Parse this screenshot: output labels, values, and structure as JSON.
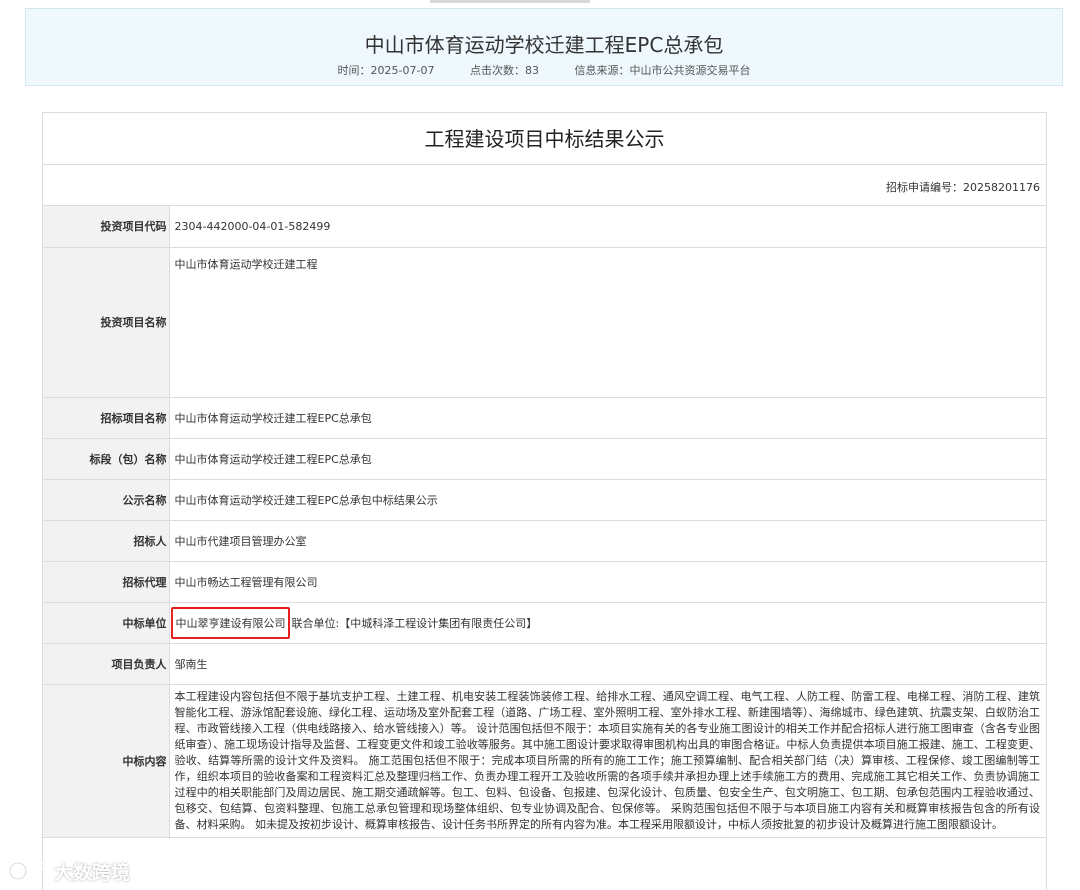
{
  "header": {
    "title": "中山市体育运动学校迁建工程EPC总承包",
    "time": "时间：2025-07-07",
    "clicks": "点击次数：83",
    "source": "信息来源：中山市公共资源交易平台"
  },
  "document": {
    "title": "工程建设项目中标结果公示",
    "apply_no": "招标申请编号：20258201176",
    "rows": [
      {
        "label": "投资项目代码",
        "value": "2304-442000-04-01-582499"
      },
      {
        "label": "投资项目名称",
        "value": "中山市体育运动学校迁建工程"
      },
      {
        "label": "招标项目名称",
        "value": "中山市体育运动学校迁建工程EPC总承包"
      },
      {
        "label": "标段（包）名称",
        "value": "中山市体育运动学校迁建工程EPC总承包"
      },
      {
        "label": "公示名称",
        "value": "中山市体育运动学校迁建工程EPC总承包中标结果公示"
      },
      {
        "label": "招标人",
        "value": "中山市代建项目管理办公室"
      },
      {
        "label": "招标代理",
        "value": "中山市畅达工程管理有限公司"
      },
      {
        "label": "中标单位",
        "winner": "中山翠亨建设有限公司",
        "partner": "联合单位:【中城科泽工程设计集团有限责任公司】"
      },
      {
        "label": "项目负责人",
        "value": "邹南生"
      },
      {
        "label": "中标内容",
        "value": "本工程建设内容包括但不限于基坑支护工程、土建工程、机电安装工程装饰装修工程、给排水工程、通风空调工程、电气工程、人防工程、防雷工程、电梯工程、消防工程、建筑智能化工程、游泳馆配套设施、绿化工程、运动场及室外配套工程（道路、广场工程、室外照明工程、室外排水工程、新建围墙等）、海绵城市、绿色建筑、抗震支架、白蚁防治工程、市政管线接入工程（供电线路接入、给水管线接入）等。 设计范围包括但不限于：本项目实施有关的各专业施工图设计的相关工作并配合招标人进行施工图审查（含各专业图纸审查）、施工现场设计指导及监督、工程变更文件和竣工验收等服务。其中施工图设计要求取得审图机构出具的审图合格证。中标人负责提供本项目施工报建、施工、工程变更、验收、结算等所需的设计文件及资料。 施工范围包括但不限于：完成本项目所需的所有的施工工作；施工预算编制、配合相关部门结（决）算审核、工程保修、竣工图编制等工作，组织本项目的验收备案和工程资料汇总及整理归档工作、负责办理工程开工及验收所需的各项手续并承担办理上述手续施工方的费用、完成施工其它相关工作、负责协调施工过程中的相关职能部门及周边居民、施工期交通疏解等。包工、包料、包设备、包报建、包深化设计、包质量、包安全生产、包文明施工、包工期、包承包范围内工程验收通过、包移交、包结算、包资料整理、包施工总承包管理和现场整体组织、包专业协调及配合、包保修等。 采购范围包括但不限于与本项目施工内容有关和概算审核报告包含的所有设备、材料采购。 如未提及按初步设计、概算审核报告、设计任务书所界定的所有内容为准。本工程采用限额设计，中标人须按批复的初步设计及概算进行施工图限额设计。"
      }
    ]
  },
  "watermark": {
    "text": "大数跨境",
    "icon": "brand-logo-icon"
  },
  "colors": {
    "header_bg": "#eef8fd",
    "label_bg": "#f2f2f2",
    "highlight": "#e3211e"
  }
}
